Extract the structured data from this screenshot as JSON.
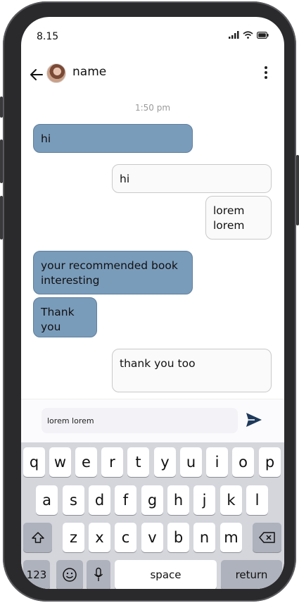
{
  "status_bar": {
    "time": "8.15"
  },
  "header": {
    "contact_name": "name"
  },
  "chat": {
    "timestamp": "1:50 pm",
    "messages": [
      {
        "direction": "incoming",
        "text": "hi"
      },
      {
        "direction": "outgoing",
        "text": "hi"
      },
      {
        "direction": "outgoing",
        "text": "lorem lorem"
      },
      {
        "direction": "incoming",
        "text": "your recommended book interesting"
      },
      {
        "direction": "incoming",
        "text": "Thank you"
      },
      {
        "direction": "outgoing",
        "text": "thank you too"
      }
    ]
  },
  "composer": {
    "value": "lorem lorem"
  },
  "keyboard": {
    "row1": [
      "q",
      "w",
      "e",
      "r",
      "t",
      "y",
      "u",
      "i",
      "o",
      "p"
    ],
    "row2": [
      "a",
      "s",
      "d",
      "f",
      "g",
      "h",
      "j",
      "k",
      "l"
    ],
    "row3": [
      "z",
      "x",
      "c",
      "v",
      "b",
      "n",
      "m"
    ],
    "numbers_label": "123",
    "space_label": "space",
    "return_label": "return"
  },
  "colors": {
    "incoming_bubble": "#7a9cbb",
    "outgoing_bubble": "#fafafa",
    "send_icon": "#1f3a5a",
    "keyboard_bg": "#d4d6dc"
  },
  "icons": {
    "back": "arrow-left-icon",
    "more": "vertical-dots-icon",
    "send": "paper-plane-icon",
    "shift": "shift-arrow-icon",
    "backspace": "backspace-icon",
    "emoji": "emoji-icon",
    "mic": "microphone-icon"
  }
}
